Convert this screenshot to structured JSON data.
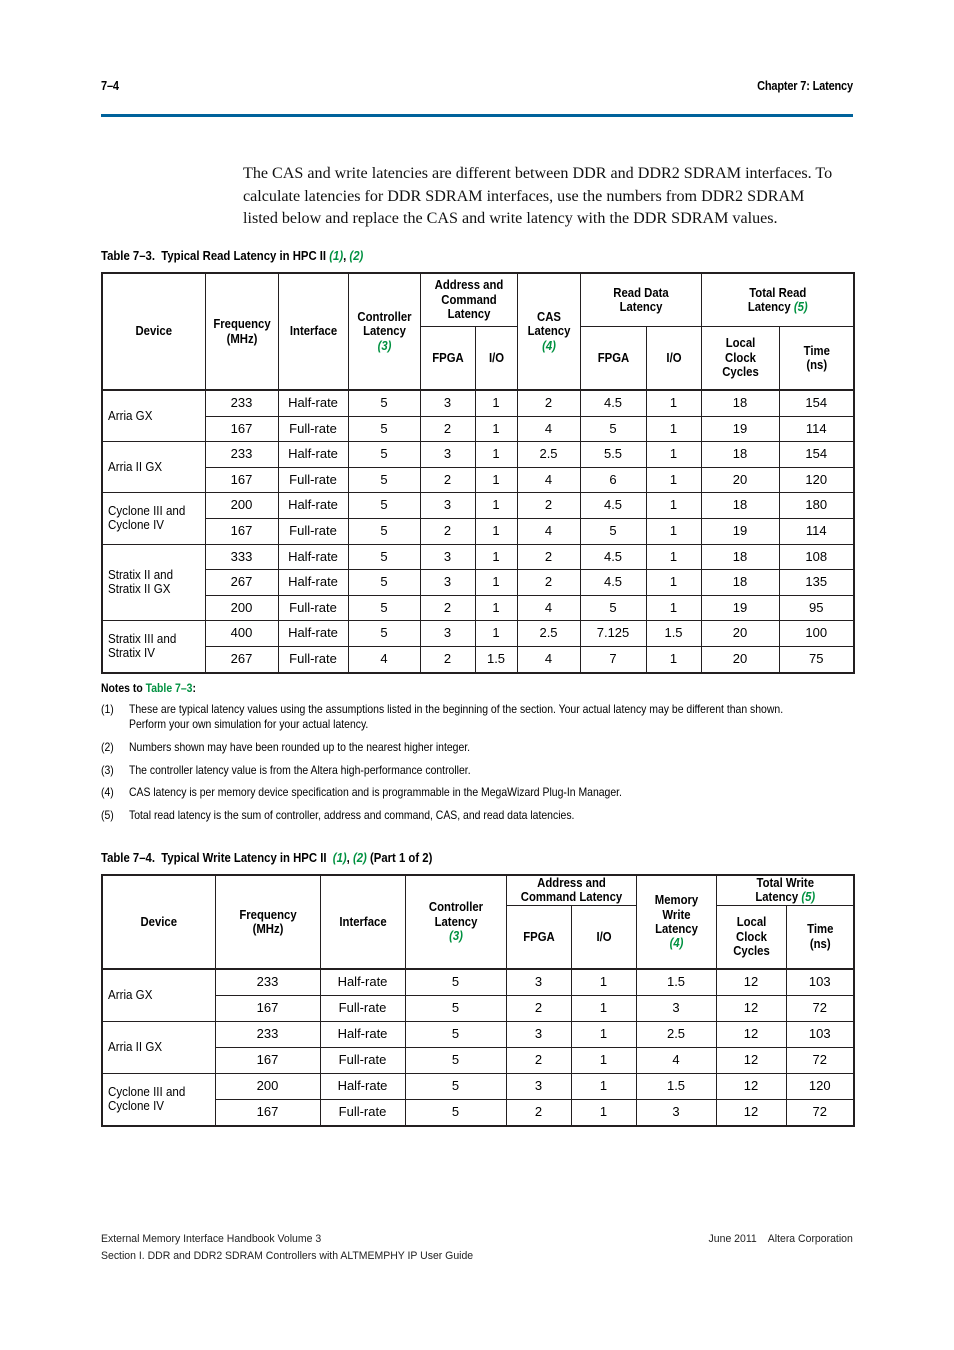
{
  "running_head": {
    "folio": "7–4",
    "chapter": "Chapter 7:  Latency"
  },
  "body_paragraph": "The CAS and write latencies are different between DDR and DDR2 SDRAM interfaces. To calculate latencies for DDR SDRAM interfaces, use the numbers from DDR2 SDRAM listed below and replace the CAS and write latency with the DDR SDRAM values.",
  "table_read": {
    "caption_label": "Table 7–3.",
    "caption_title": "Typical Read Latency in HPC II",
    "caption_notes": [
      "(1)",
      "(2)"
    ],
    "headers": {
      "device": "Device",
      "frequency": "Frequency\n(MHz)",
      "frequency_l1": "Frequency",
      "frequency_l2": "(MHz)",
      "interface": "Interface",
      "controller_latency_l1": "Controller",
      "controller_latency_l2": "Latency",
      "controller_latency_note": "(3)",
      "addr_cmd_l1": "Address and",
      "addr_cmd_l2": "Command",
      "addr_cmd_l3": "Latency",
      "addr_fpga": "FPGA",
      "addr_io": "I/O",
      "cas_l1": "CAS",
      "cas_l2": "Latency",
      "cas_note": "(4)",
      "read_data_l1": "Read Data",
      "read_data_l2": "Latency",
      "read_fpga": "FPGA",
      "read_io": "I/O",
      "total_l1": "Total Read",
      "total_l2": "Latency",
      "total_note": "(5)",
      "local_clock_l1": "Local",
      "local_clock_l2": "Clock",
      "local_clock_l3": "Cycles",
      "time_l1": "Time",
      "time_l2": "(ns)"
    },
    "groups": [
      {
        "device": [
          "Arria GX"
        ],
        "rows": [
          {
            "freq": "233",
            "interface": "Half-rate",
            "ctrl": "5",
            "addr_fpga": "3",
            "addr_io": "1",
            "cas": "2",
            "rd_fpga": "4.5",
            "rd_io": "1",
            "cycles": "18",
            "time": "154"
          },
          {
            "freq": "167",
            "interface": "Full-rate",
            "ctrl": "5",
            "addr_fpga": "2",
            "addr_io": "1",
            "cas": "4",
            "rd_fpga": "5",
            "rd_io": "1",
            "cycles": "19",
            "time": "114"
          }
        ]
      },
      {
        "device": [
          "Arria II GX"
        ],
        "rows": [
          {
            "freq": "233",
            "interface": "Half-rate",
            "ctrl": "5",
            "addr_fpga": "3",
            "addr_io": "1",
            "cas": "2.5",
            "rd_fpga": "5.5",
            "rd_io": "1",
            "cycles": "18",
            "time": "154"
          },
          {
            "freq": "167",
            "interface": "Full-rate",
            "ctrl": "5",
            "addr_fpga": "2",
            "addr_io": "1",
            "cas": "4",
            "rd_fpga": "6",
            "rd_io": "1",
            "cycles": "20",
            "time": "120"
          }
        ]
      },
      {
        "device": [
          "Cyclone III and",
          "Cyclone IV"
        ],
        "rows": [
          {
            "freq": "200",
            "interface": "Half-rate",
            "ctrl": "5",
            "addr_fpga": "3",
            "addr_io": "1",
            "cas": "2",
            "rd_fpga": "4.5",
            "rd_io": "1",
            "cycles": "18",
            "time": "180"
          },
          {
            "freq": "167",
            "interface": "Full-rate",
            "ctrl": "5",
            "addr_fpga": "2",
            "addr_io": "1",
            "cas": "4",
            "rd_fpga": "5",
            "rd_io": "1",
            "cycles": "19",
            "time": "114"
          }
        ]
      },
      {
        "device": [
          "Stratix II and",
          "Stratix II GX"
        ],
        "rows": [
          {
            "freq": "333",
            "interface": "Half-rate",
            "ctrl": "5",
            "addr_fpga": "3",
            "addr_io": "1",
            "cas": "2",
            "rd_fpga": "4.5",
            "rd_io": "1",
            "cycles": "18",
            "time": "108"
          },
          {
            "freq": "267",
            "interface": "Half-rate",
            "ctrl": "5",
            "addr_fpga": "3",
            "addr_io": "1",
            "cas": "2",
            "rd_fpga": "4.5",
            "rd_io": "1",
            "cycles": "18",
            "time": "135"
          },
          {
            "freq": "200",
            "interface": "Full-rate",
            "ctrl": "5",
            "addr_fpga": "2",
            "addr_io": "1",
            "cas": "4",
            "rd_fpga": "5",
            "rd_io": "1",
            "cycles": "19",
            "time": "95"
          }
        ]
      },
      {
        "device": [
          "Stratix III and",
          "Stratix IV"
        ],
        "rows": [
          {
            "freq": "400",
            "interface": "Half-rate",
            "ctrl": "5",
            "addr_fpga": "3",
            "addr_io": "1",
            "cas": "2.5",
            "rd_fpga": "7.125",
            "rd_io": "1.5",
            "cycles": "20",
            "time": "100"
          },
          {
            "freq": "267",
            "interface": "Full-rate",
            "ctrl": "4",
            "addr_fpga": "2",
            "addr_io": "1.5",
            "cas": "4",
            "rd_fpga": "7",
            "rd_io": "1",
            "cycles": "20",
            "time": "75"
          }
        ]
      }
    ],
    "notes_heading_pre": "Notes to ",
    "notes_heading_ref": "Table 7–3",
    "notes_heading_post": ":",
    "notes": [
      {
        "num": "(1)",
        "text": "These are typical latency values using the assumptions listed in the beginning of the section. Your actual latency may be different than shown. Perform your own simulation for your actual latency."
      },
      {
        "num": "(2)",
        "text": "Numbers shown may have been rounded up to the nearest higher integer."
      },
      {
        "num": "(3)",
        "text": "The controller latency value is from the Altera high-performance controller."
      },
      {
        "num": "(4)",
        "text": "CAS latency is per memory device specification and is programmable in the MegaWizard Plug-In Manager."
      },
      {
        "num": "(5)",
        "text": "Total read latency is the sum of controller, address and command, CAS, and read data latencies."
      }
    ]
  },
  "table_write": {
    "caption_label": "Table 7–4.",
    "caption_title": "Typical Write Latency in HPC II",
    "caption_notes": [
      "(1)",
      "(2)"
    ],
    "caption_part": "(Part 1 of 2)",
    "headers": {
      "device": "Device",
      "frequency_l1": "Frequency",
      "frequency_l2": "(MHz)",
      "interface": "Interface",
      "controller_latency_l1": "Controller",
      "controller_latency_l2": "Latency",
      "controller_latency_note": "(3)",
      "addr_cmd_l1": "Address and",
      "addr_cmd_l2": "Command Latency",
      "addr_fpga": "FPGA",
      "addr_io": "I/O",
      "mem_write_l1": "Memory",
      "mem_write_l2": "Write",
      "mem_write_l3": "Latency",
      "mem_write_note": "(4)",
      "total_l1": "Total Write",
      "total_l2": "Latency",
      "total_note": "(5)",
      "local_clock_l1": "Local",
      "local_clock_l2": "Clock",
      "local_clock_l3": "Cycles",
      "time_l1": "Time",
      "time_l2": "(ns)"
    },
    "groups": [
      {
        "device": [
          "Arria GX"
        ],
        "rows": [
          {
            "freq": "233",
            "interface": "Half-rate",
            "ctrl": "5",
            "addr_fpga": "3",
            "addr_io": "1",
            "mem_write": "1.5",
            "cycles": "12",
            "time": "103"
          },
          {
            "freq": "167",
            "interface": "Full-rate",
            "ctrl": "5",
            "addr_fpga": "2",
            "addr_io": "1",
            "mem_write": "3",
            "cycles": "12",
            "time": "72"
          }
        ]
      },
      {
        "device": [
          "Arria II GX"
        ],
        "rows": [
          {
            "freq": "233",
            "interface": "Half-rate",
            "ctrl": "5",
            "addr_fpga": "3",
            "addr_io": "1",
            "mem_write": "2.5",
            "cycles": "12",
            "time": "103"
          },
          {
            "freq": "167",
            "interface": "Full-rate",
            "ctrl": "5",
            "addr_fpga": "2",
            "addr_io": "1",
            "mem_write": "4",
            "cycles": "12",
            "time": "72"
          }
        ]
      },
      {
        "device": [
          "Cyclone III and",
          "Cyclone IV"
        ],
        "rows": [
          {
            "freq": "200",
            "interface": "Half-rate",
            "ctrl": "5",
            "addr_fpga": "3",
            "addr_io": "1",
            "mem_write": "1.5",
            "cycles": "12",
            "time": "120"
          },
          {
            "freq": "167",
            "interface": "Full-rate",
            "ctrl": "5",
            "addr_fpga": "2",
            "addr_io": "1",
            "mem_write": "3",
            "cycles": "12",
            "time": "72"
          }
        ]
      }
    ]
  },
  "footer": {
    "left_line1": "External Memory Interface Handbook Volume 3",
    "left_line2": "Section I. DDR and DDR2 SDRAM Controllers with ALTMEMPHY IP User Guide",
    "right_date": "June 2011",
    "right_corp": "Altera Corporation"
  },
  "colors": {
    "rule_blue": "#00629b",
    "note_green": "#009140",
    "ink": "#231f20"
  }
}
